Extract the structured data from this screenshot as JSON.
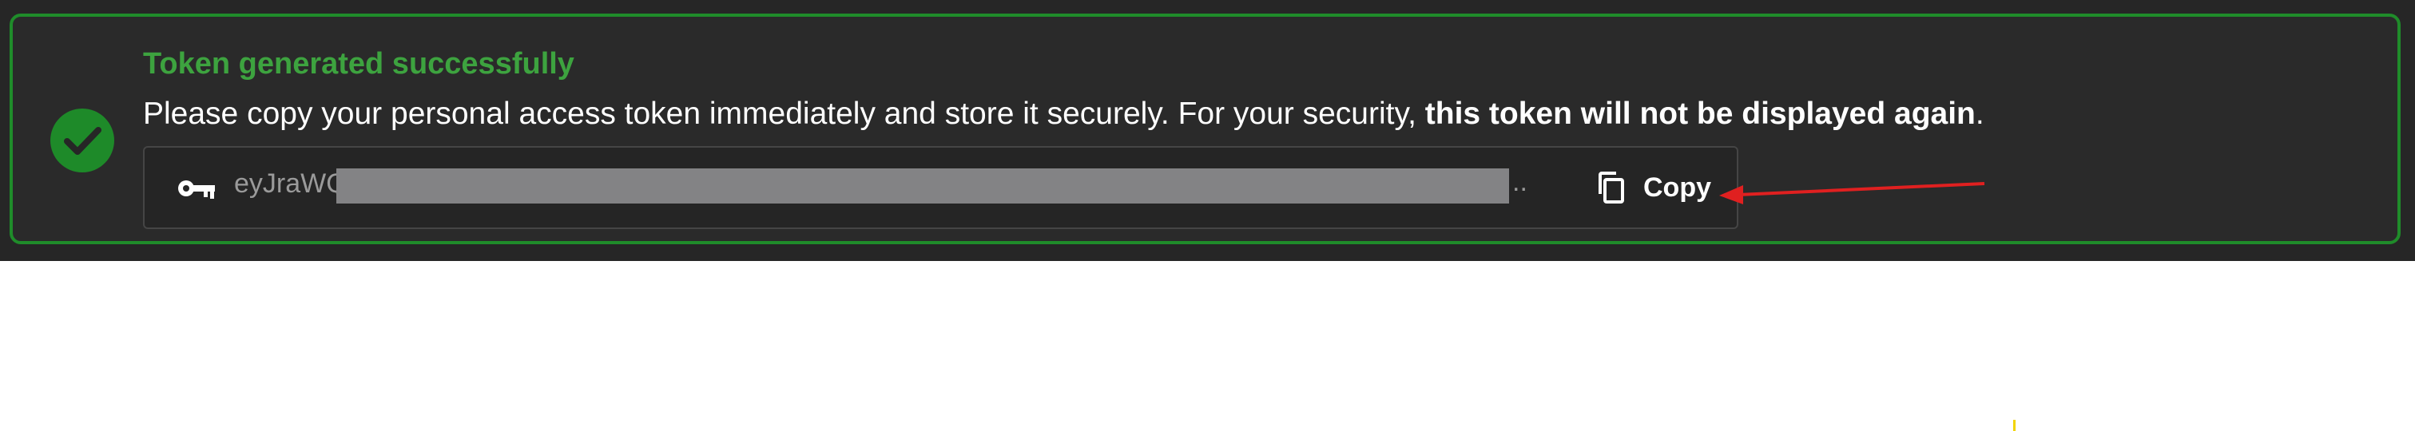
{
  "notification": {
    "title": "Token generated successfully",
    "message_prefix": "Please copy your personal access token immediately and store it securely. For your security, ",
    "message_bold": "this token will not be displayed again",
    "message_suffix": ".",
    "status_color": "#3da33f",
    "icon": "check-circle-icon"
  },
  "token_field": {
    "icon": "key-icon",
    "value_visible": "eyJraWQ",
    "ellipsis": "..",
    "redacted": true
  },
  "copy_button": {
    "label": "Copy",
    "icon": "copy-icon"
  },
  "annotation": {
    "arrow_color": "#e02020",
    "points_to": "copy-button"
  }
}
